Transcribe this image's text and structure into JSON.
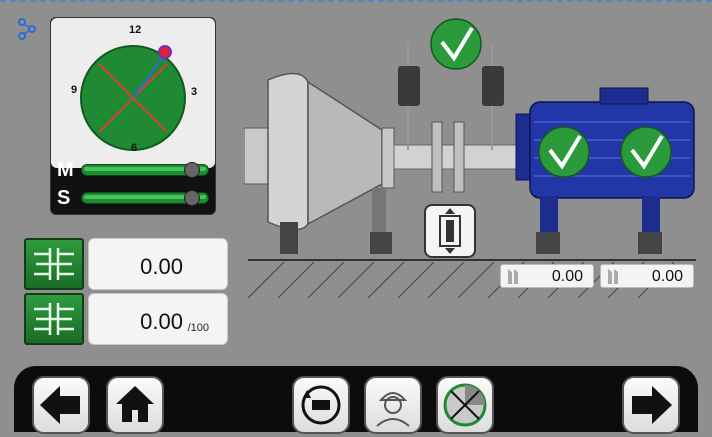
{
  "compass": {
    "labels": {
      "top": "12",
      "right": "3",
      "bottom": "6",
      "left": "9"
    },
    "rows": [
      {
        "letter": "M",
        "level": 0.82
      },
      {
        "letter": "S",
        "level": 0.82
      }
    ]
  },
  "values": [
    {
      "value": "0.00",
      "unit": ""
    },
    {
      "value": "0.00",
      "unit": "/100"
    }
  ],
  "feet": [
    {
      "value": "0.00"
    },
    {
      "value": "0.00"
    }
  ],
  "colors": {
    "background": "#8f8f8f",
    "accent_green": "#1f8a33",
    "dial_red": "#d9432a",
    "motor_blue": "#1d2c8f",
    "pointer_blue": "#2c6bd8"
  },
  "icons": [
    "bluetooth-icon",
    "battery-icon",
    "coupling-icon",
    "check-icon",
    "vertical-adjust-icon",
    "back-arrow-icon",
    "home-icon",
    "rotate-machine-icon",
    "operator-icon",
    "target-icon",
    "forward-arrow-icon"
  ]
}
